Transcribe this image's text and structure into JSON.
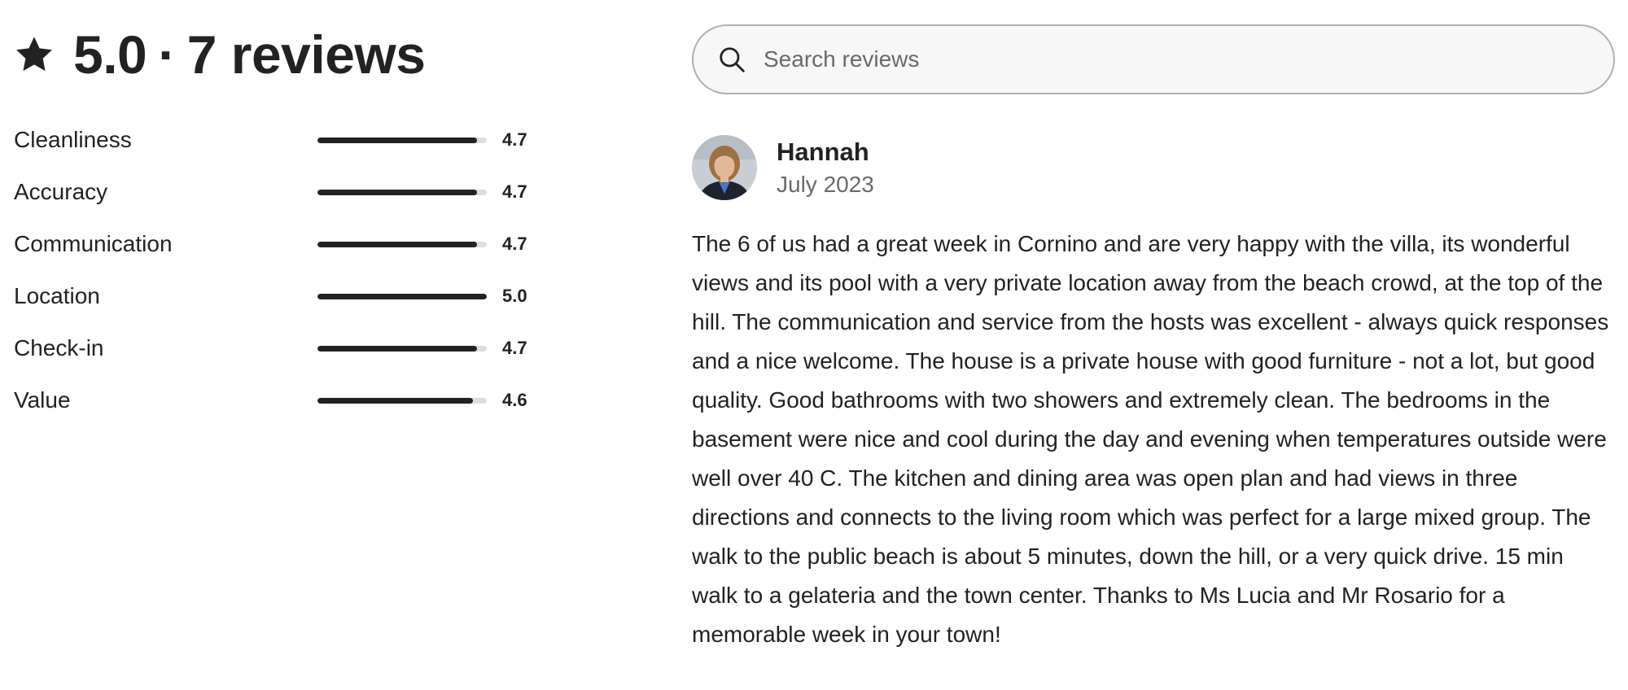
{
  "summary": {
    "rating": "5.0",
    "separator": "·",
    "reviews_count_label": "7 reviews",
    "icon": "star-icon"
  },
  "categories": [
    {
      "label": "Cleanliness",
      "value": "4.7",
      "score": 4.7
    },
    {
      "label": "Accuracy",
      "value": "4.7",
      "score": 4.7
    },
    {
      "label": "Communication",
      "value": "4.7",
      "score": 4.7
    },
    {
      "label": "Location",
      "value": "5.0",
      "score": 5.0
    },
    {
      "label": "Check-in",
      "value": "4.7",
      "score": 4.7
    },
    {
      "label": "Value",
      "value": "4.6",
      "score": 4.6
    }
  ],
  "rating_max": 5,
  "search": {
    "placeholder": "Search reviews",
    "value": "",
    "icon": "search-icon"
  },
  "review": {
    "name": "Hannah",
    "date": "July 2023",
    "text": "The 6 of us had a great week in Cornino and are very happy with the villa, its wonderful views and its pool with a very private location away from the beach crowd, at the top of the hill. The communication and service from the hosts was excellent - always quick responses and a nice welcome. The house is a private house with good furniture - not a lot, but good quality. Good bathrooms with two showers and extremely clean. The bedrooms in the basement were nice and cool during the day and evening when temperatures outside were well over 40 C. The kitchen and dining area was open plan and had views in three directions and connects to the living room which was perfect for a large mixed group. The walk to the public beach is about 5 minutes, down the hill, or a very quick drive. 15 min walk to a gelateria and the town center. Thanks to Ms Lucia and Mr Rosario for a memorable week in your town!"
  },
  "colors": {
    "text": "#222222",
    "muted": "#6a6a6a",
    "bar_track": "#dddddd",
    "bar_fill": "#222222",
    "search_bg": "#f7f7f7",
    "search_border": "#b0b0b0"
  }
}
